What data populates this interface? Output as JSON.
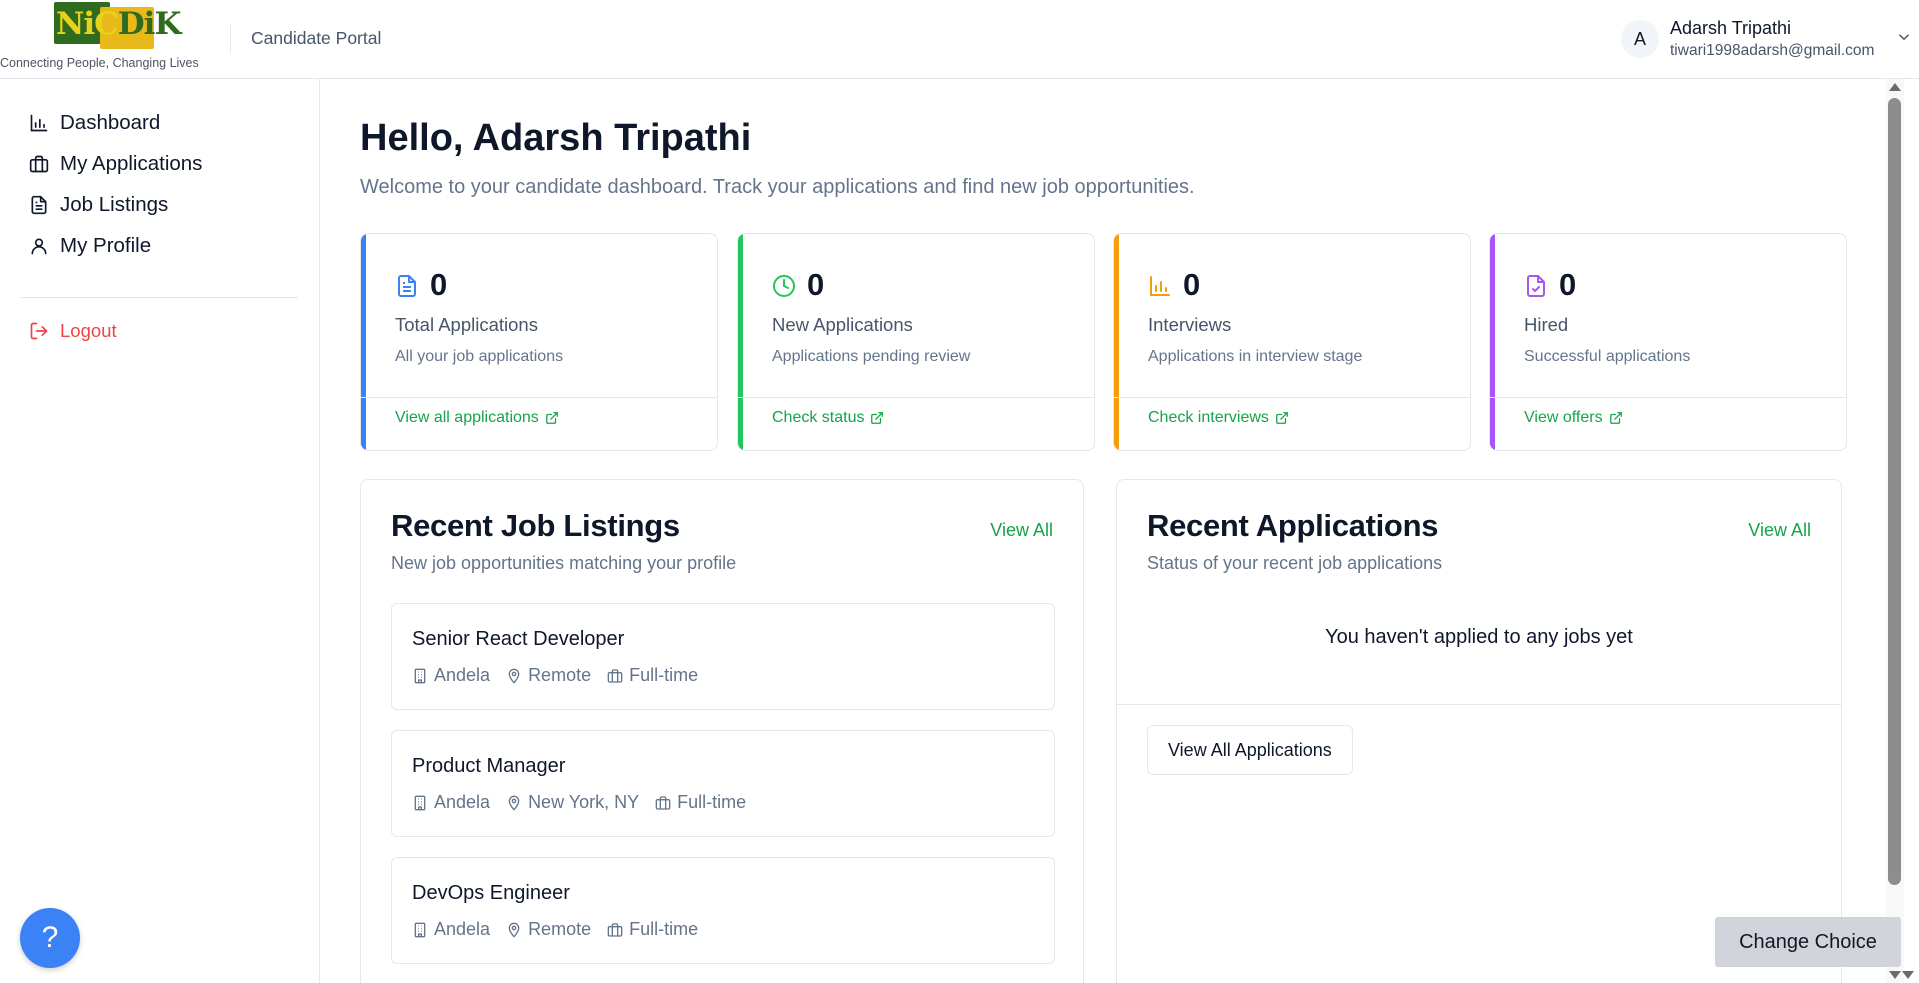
{
  "header": {
    "logo_text": "NiCDiK",
    "tagline": "Connecting People, Changing Lives",
    "portal_label": "Candidate Portal",
    "user": {
      "initial": "A",
      "name": "Adarsh Tripathi",
      "email": "tiwari1998adarsh@gmail.com"
    }
  },
  "sidebar": {
    "items": [
      {
        "label": "Dashboard",
        "icon": "bar-chart-icon"
      },
      {
        "label": "My Applications",
        "icon": "briefcase-icon"
      },
      {
        "label": "Job Listings",
        "icon": "document-icon"
      },
      {
        "label": "My Profile",
        "icon": "user-icon"
      }
    ],
    "logout_label": "Logout",
    "help_label": "?"
  },
  "main": {
    "greeting": "Hello, Adarsh Tripathi",
    "welcome": "Welcome to your candidate dashboard. Track your applications and find new job opportunities.",
    "stats": [
      {
        "count": "0",
        "title": "Total Applications",
        "desc": "All your job applications",
        "link": "View all applications",
        "color": "#3b82f6",
        "icon": "document-icon"
      },
      {
        "count": "0",
        "title": "New Applications",
        "desc": "Applications pending review",
        "link": "Check status",
        "color": "#22c55e",
        "icon": "clock-icon"
      },
      {
        "count": "0",
        "title": "Interviews",
        "desc": "Applications in interview stage",
        "link": "Check interviews",
        "color": "#f59e0b",
        "icon": "bar-chart-icon"
      },
      {
        "count": "0",
        "title": "Hired",
        "desc": "Successful applications",
        "link": "View offers",
        "color": "#a855f7",
        "icon": "file-check-icon"
      }
    ],
    "recent_jobs": {
      "title": "Recent Job Listings",
      "subtitle": "New job opportunities matching your profile",
      "view_all": "View All",
      "jobs": [
        {
          "title": "Senior React Developer",
          "company": "Andela",
          "location": "Remote",
          "type": "Full-time"
        },
        {
          "title": "Product Manager",
          "company": "Andela",
          "location": "New York, NY",
          "type": "Full-time"
        },
        {
          "title": "DevOps Engineer",
          "company": "Andela",
          "location": "Remote",
          "type": "Full-time"
        }
      ]
    },
    "recent_apps": {
      "title": "Recent Applications",
      "subtitle": "Status of your recent job applications",
      "view_all": "View All",
      "empty_text": "You haven't applied to any jobs yet",
      "button": "View All Applications"
    }
  },
  "change_choice": "Change Choice"
}
